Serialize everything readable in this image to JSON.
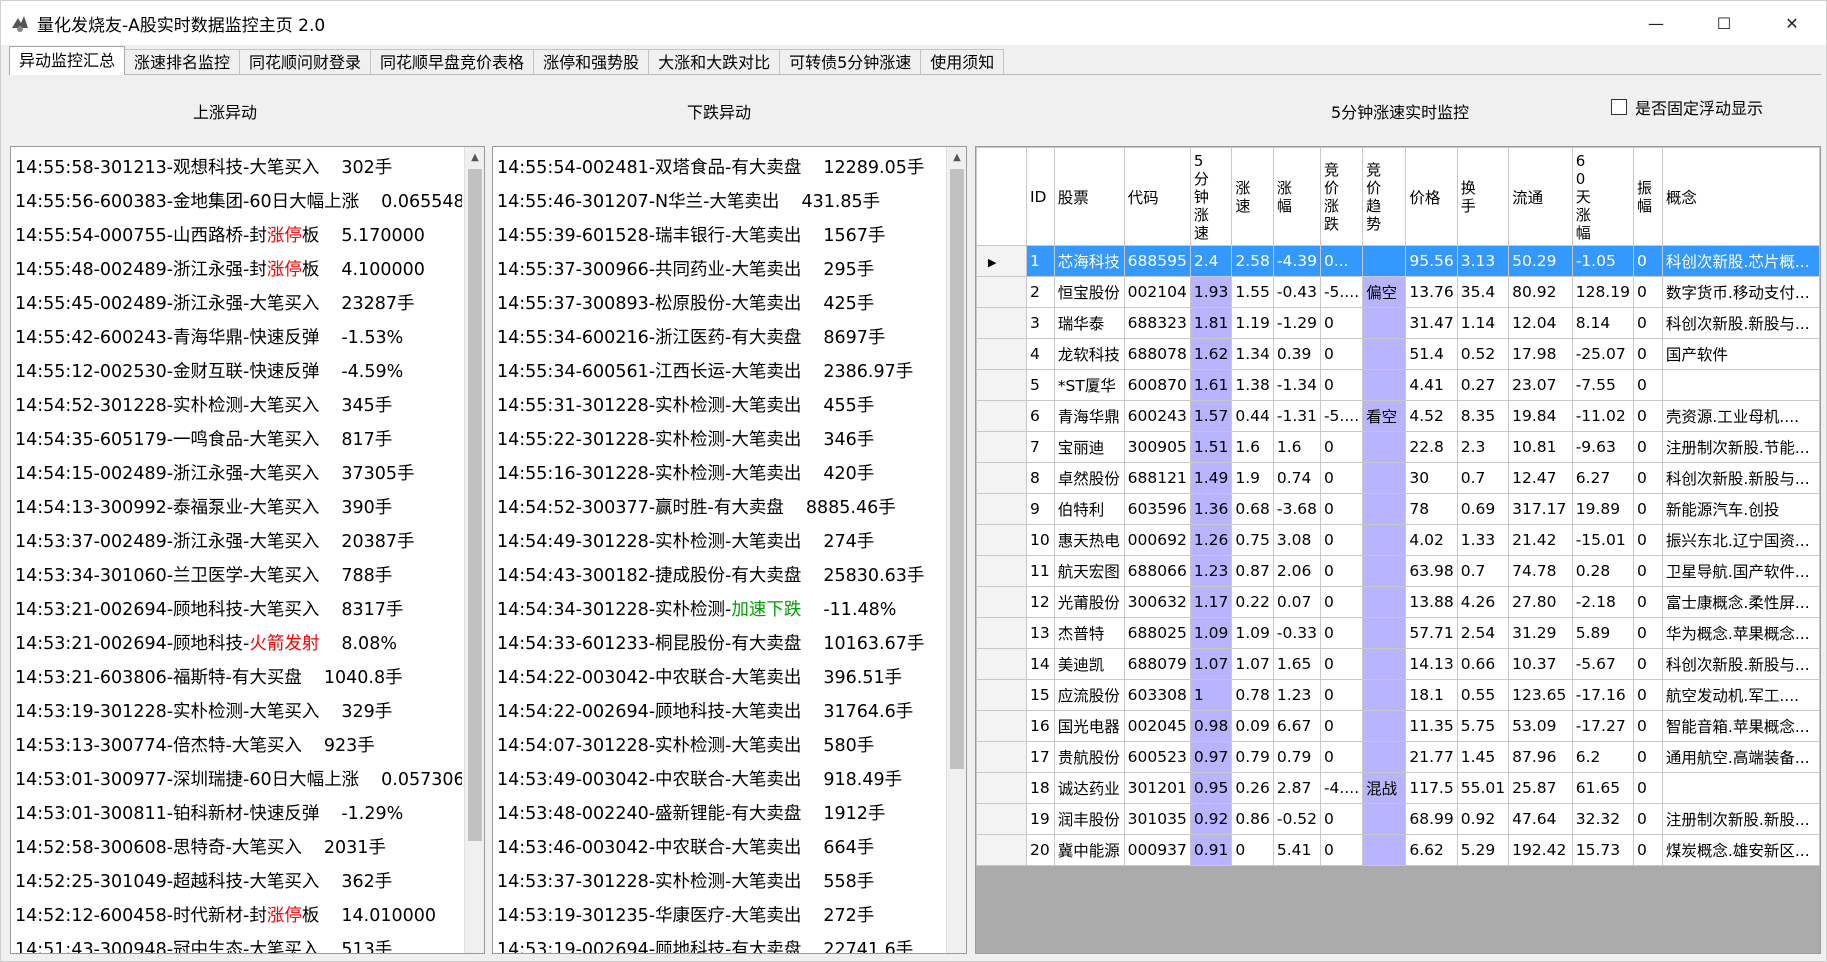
{
  "window": {
    "title": "量化发烧友-A股实时数据监控主页 2.0",
    "minimize": "—",
    "maximize": "☐",
    "close": "✕"
  },
  "tabs": [
    "异动监控汇总",
    "涨速排名监控",
    "同花顺问财登录",
    "同花顺早盘竞价表格",
    "涨停和强势股",
    "大涨和大跌对比",
    "可转债5分钟涨速",
    "使用须知"
  ],
  "active_tab": 0,
  "headers": {
    "rise": "上涨异动",
    "fall": "下跌异动",
    "speed": "5分钟涨速实时监控",
    "fixed_float": "是否固定浮动显示"
  },
  "rise_list": [
    {
      "main": "14:55:58-301213-观想科技-大笔买入",
      "val": "302手"
    },
    {
      "main": "14:55:56-600383-金地集团-60日大幅上涨",
      "val": "0.065548"
    },
    {
      "main": "14:55:54-000755-山西路桥-封",
      "hl": "涨停",
      "hlc": "red",
      "tail": "板",
      "val": "5.170000"
    },
    {
      "main": "14:55:48-002489-浙江永强-封",
      "hl": "涨停",
      "hlc": "red",
      "tail": "板",
      "val": "4.100000"
    },
    {
      "main": "14:55:45-002489-浙江永强-大笔买入",
      "val": "23287手"
    },
    {
      "main": "14:55:42-600243-青海华鼎-快速反弹",
      "val": "-1.53%"
    },
    {
      "main": "14:55:12-002530-金财互联-快速反弹",
      "val": "-4.59%"
    },
    {
      "main": "14:54:52-301228-实朴检测-大笔买入",
      "val": "345手"
    },
    {
      "main": "14:54:35-605179-一鸣食品-大笔买入",
      "val": "817手"
    },
    {
      "main": "14:54:15-002489-浙江永强-大笔买入",
      "val": "37305手"
    },
    {
      "main": "14:54:13-300992-泰福泵业-大笔买入",
      "val": "390手"
    },
    {
      "main": "14:53:37-002489-浙江永强-大笔买入",
      "val": "20387手"
    },
    {
      "main": "14:53:34-301060-兰卫医学-大笔买入",
      "val": "788手"
    },
    {
      "main": "14:53:21-002694-顾地科技-大笔买入",
      "val": "8317手"
    },
    {
      "main": "14:53:21-002694-顾地科技-",
      "hl": "火箭发射",
      "hlc": "red",
      "tail": "",
      "val": "8.08%"
    },
    {
      "main": "14:53:21-603806-福斯特-有大买盘",
      "val": "1040.8手"
    },
    {
      "main": "14:53:19-301228-实朴检测-大笔买入",
      "val": "329手"
    },
    {
      "main": "14:53:13-300774-倍杰特-大笔买入",
      "val": "923手"
    },
    {
      "main": "14:53:01-300977-深圳瑞捷-60日大幅上涨",
      "val": "0.057306"
    },
    {
      "main": "14:53:01-300811-铂科新材-快速反弹",
      "val": "-1.29%"
    },
    {
      "main": "14:52:58-300608-思特奇-大笔买入",
      "val": "2031手"
    },
    {
      "main": "14:52:25-301049-超越科技-大笔买入",
      "val": "362手"
    },
    {
      "main": "14:52:12-600458-时代新材-封",
      "hl": "涨停",
      "hlc": "red",
      "tail": "板",
      "val": "14.010000"
    },
    {
      "main": "14:51:43-300948-冠中生态-大笔买入",
      "val": "513手"
    }
  ],
  "fall_list": [
    {
      "main": "14:55:54-002481-双塔食品-有大卖盘",
      "val": "12289.05手"
    },
    {
      "main": "14:55:46-301207-N华兰-大笔卖出",
      "val": "431.85手"
    },
    {
      "main": "14:55:39-601528-瑞丰银行-大笔卖出",
      "val": "1567手"
    },
    {
      "main": "14:55:37-300966-共同药业-大笔卖出",
      "val": "295手"
    },
    {
      "main": "14:55:37-300893-松原股份-大笔卖出",
      "val": "425手"
    },
    {
      "main": "14:55:34-600216-浙江医药-有大卖盘",
      "val": "8697手"
    },
    {
      "main": "14:55:34-600561-江西长运-大笔卖出",
      "val": "2386.97手"
    },
    {
      "main": "14:55:31-301228-实朴检测-大笔卖出",
      "val": "455手"
    },
    {
      "main": "14:55:22-301228-实朴检测-大笔卖出",
      "val": "346手"
    },
    {
      "main": "14:55:16-301228-实朴检测-大笔卖出",
      "val": "420手"
    },
    {
      "main": "14:54:52-300377-赢时胜-有大卖盘",
      "val": "8885.46手"
    },
    {
      "main": "14:54:49-301228-实朴检测-大笔卖出",
      "val": "274手"
    },
    {
      "main": "14:54:43-300182-捷成股份-有大卖盘",
      "val": "25830.63手"
    },
    {
      "main": "14:54:34-301228-实朴检测-",
      "hl": "加速下跌",
      "hlc": "green",
      "tail": "",
      "val": "-11.48%"
    },
    {
      "main": "14:54:33-601233-桐昆股份-有大卖盘",
      "val": "10163.67手"
    },
    {
      "main": "14:54:22-003042-中农联合-大笔卖出",
      "val": "396.51手"
    },
    {
      "main": "14:54:22-002694-顾地科技-大笔卖出",
      "val": "31764.6手"
    },
    {
      "main": "14:54:07-301228-实朴检测-大笔卖出",
      "val": "580手"
    },
    {
      "main": "14:53:49-003042-中农联合-大笔卖出",
      "val": "918.49手"
    },
    {
      "main": "14:53:48-002240-盛新锂能-有大卖盘",
      "val": "1912手"
    },
    {
      "main": "14:53:46-003042-中农联合-大笔卖出",
      "val": "664手"
    },
    {
      "main": "14:53:37-301228-实朴检测-大笔卖出",
      "val": "558手"
    },
    {
      "main": "14:53:19-301235-华康医疗-大笔卖出",
      "val": "272手"
    },
    {
      "main": "14:53:19-002694-顾地科技-有大卖盘",
      "val": "22741.6手"
    }
  ],
  "grid": {
    "columns": [
      "ID",
      "股票",
      "代码",
      "5分钟涨速",
      "涨速",
      "涨幅",
      "竞价涨跌",
      "竞价趋势",
      "价格",
      "换手",
      "流通",
      "60天涨幅",
      "振幅",
      "概念"
    ],
    "selected_row": 0,
    "row_pointer": "▶",
    "rows": [
      [
        "1",
        "芯海科技",
        "688595",
        "2.4",
        "2.58",
        "-4.39",
        "0...",
        "",
        "95.56",
        "3.13",
        "50.29",
        "-1.05",
        "0",
        "科创次新股.芯片概..."
      ],
      [
        "2",
        "恒宝股份",
        "002104",
        "1.93",
        "1.55",
        "-0.43",
        "-5....",
        "偏空",
        "13.76",
        "35.4",
        "80.92",
        "128.19",
        "0",
        "数字货币.移动支付..."
      ],
      [
        "3",
        "瑞华泰",
        "688323",
        "1.81",
        "1.19",
        "-1.29",
        "0",
        "",
        "31.47",
        "1.14",
        "12.04",
        "8.14",
        "0",
        "科创次新股.新股与..."
      ],
      [
        "4",
        "龙软科技",
        "688078",
        "1.62",
        "1.34",
        "0.39",
        "0",
        "",
        "51.4",
        "0.52",
        "17.98",
        "-25.07",
        "0",
        "国产软件"
      ],
      [
        "5",
        "*ST厦华",
        "600870",
        "1.61",
        "1.38",
        "-1.34",
        "0",
        "",
        "4.41",
        "0.27",
        "23.07",
        "-7.55",
        "0",
        ""
      ],
      [
        "6",
        "青海华鼎",
        "600243",
        "1.57",
        "0.44",
        "-1.31",
        "-5....",
        "看空",
        "4.52",
        "8.35",
        "19.84",
        "-11.02",
        "0",
        "壳资源.工业母机...."
      ],
      [
        "7",
        "宝丽迪",
        "300905",
        "1.51",
        "1.6",
        "1.6",
        "0",
        "",
        "22.8",
        "2.3",
        "10.81",
        "-9.63",
        "0",
        "注册制次新股.节能..."
      ],
      [
        "8",
        "卓然股份",
        "688121",
        "1.49",
        "1.9",
        "0.74",
        "0",
        "",
        "30",
        "0.7",
        "12.47",
        "6.27",
        "0",
        "科创次新股.新股与..."
      ],
      [
        "9",
        "伯特利",
        "603596",
        "1.36",
        "0.68",
        "-3.68",
        "0",
        "",
        "78",
        "0.69",
        "317.17",
        "19.89",
        "0",
        "新能源汽车.创投"
      ],
      [
        "10",
        "惠天热电",
        "000692",
        "1.26",
        "0.75",
        "3.08",
        "0",
        "",
        "4.02",
        "1.33",
        "21.42",
        "-15.01",
        "0",
        "振兴东北.辽宁国资..."
      ],
      [
        "11",
        "航天宏图",
        "688066",
        "1.23",
        "0.87",
        "2.06",
        "0",
        "",
        "63.98",
        "0.7",
        "74.78",
        "0.28",
        "0",
        "卫星导航.国产软件..."
      ],
      [
        "12",
        "光莆股份",
        "300632",
        "1.17",
        "0.22",
        "0.07",
        "0",
        "",
        "13.88",
        "4.26",
        "27.80",
        "-2.18",
        "0",
        "富士康概念.柔性屏..."
      ],
      [
        "13",
        "杰普特",
        "688025",
        "1.09",
        "1.09",
        "-0.33",
        "0",
        "",
        "57.71",
        "2.54",
        "31.29",
        "5.89",
        "0",
        "华为概念.苹果概念..."
      ],
      [
        "14",
        "美迪凯",
        "688079",
        "1.07",
        "1.07",
        "1.65",
        "0",
        "",
        "14.13",
        "0.66",
        "10.37",
        "-5.67",
        "0",
        "科创次新股.新股与..."
      ],
      [
        "15",
        "应流股份",
        "603308",
        "1",
        "0.78",
        "1.23",
        "0",
        "",
        "18.1",
        "0.55",
        "123.65",
        "-17.16",
        "0",
        "航空发动机.军工...."
      ],
      [
        "16",
        "国光电器",
        "002045",
        "0.98",
        "0.09",
        "6.67",
        "0",
        "",
        "11.35",
        "5.75",
        "53.09",
        "-17.27",
        "0",
        "智能音箱.苹果概念..."
      ],
      [
        "17",
        "贵航股份",
        "600523",
        "0.97",
        "0.79",
        "0.79",
        "0",
        "",
        "21.77",
        "1.45",
        "87.96",
        "6.2",
        "0",
        "通用航空.高端装备..."
      ],
      [
        "18",
        "诚达药业",
        "301201",
        "0.95",
        "0.26",
        "2.87",
        "-4....",
        "混战",
        "117.5",
        "55.01",
        "25.87",
        "61.65",
        "0",
        ""
      ],
      [
        "19",
        "润丰股份",
        "301035",
        "0.92",
        "0.86",
        "-0.52",
        "0",
        "",
        "68.99",
        "0.92",
        "47.64",
        "32.32",
        "0",
        "注册制次新股.新股..."
      ],
      [
        "20",
        "冀中能源",
        "000937",
        "0.91",
        "0",
        "5.41",
        "0",
        "",
        "6.62",
        "5.29",
        "192.42",
        "15.73",
        "0",
        "煤炭概念.雄安新区..."
      ]
    ]
  },
  "colors": {
    "highlight_column": "#b9b4ff",
    "selection": "#3399ff",
    "red": "#ff0000",
    "green": "#00a000"
  }
}
